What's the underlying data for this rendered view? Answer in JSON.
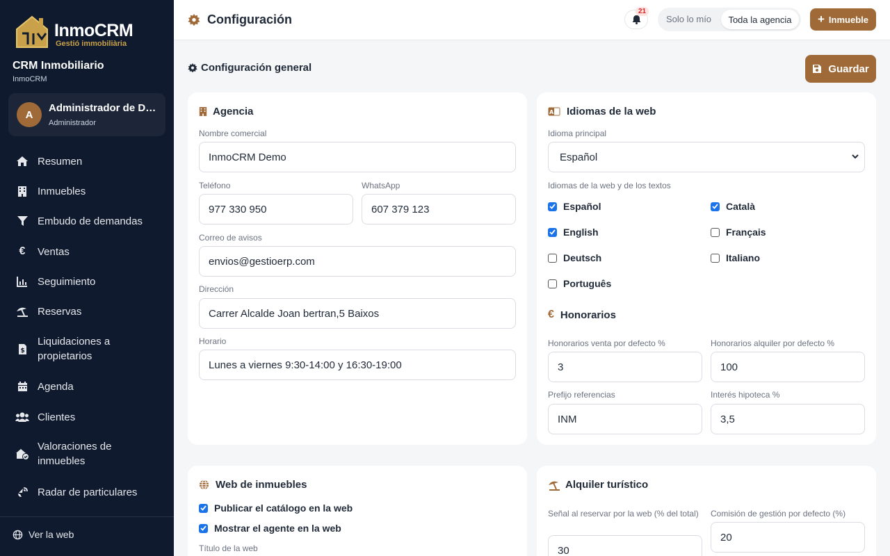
{
  "brand": {
    "name": "InmoCRM",
    "tagline": "Gestió immobiliària",
    "accent": "#a06a38"
  },
  "app": {
    "title": "CRM Inmobiliario",
    "subtitle": "InmoCRM"
  },
  "user": {
    "initial": "A",
    "name": "Administrador de Demo",
    "role": "Administrador"
  },
  "nav": [
    {
      "label": "Resumen",
      "icon": "home-icon"
    },
    {
      "label": "Inmuebles",
      "icon": "building-icon"
    },
    {
      "label": "Embudo de demandas",
      "icon": "funnel-icon"
    },
    {
      "label": "Ventas",
      "icon": "euro-icon"
    },
    {
      "label": "Seguimiento",
      "icon": "chart-icon"
    },
    {
      "label": "Reservas",
      "icon": "umbrella-beach-icon"
    },
    {
      "label": "Liquidaciones a propietarios",
      "icon": "receipt-icon"
    },
    {
      "label": "Agenda",
      "icon": "calendar-icon"
    },
    {
      "label": "Clientes",
      "icon": "users-icon"
    },
    {
      "label": "Valoraciones de inmuebles",
      "icon": "house-check-icon"
    },
    {
      "label": "Radar de particulares",
      "icon": "radar-icon"
    }
  ],
  "footer": {
    "ver_web": "Ver la web"
  },
  "topbar": {
    "title": "Configuración",
    "notifications": "21",
    "scope_options": [
      "Solo lo mío",
      "Toda la agencia"
    ],
    "scope_selected": "Toda la agencia",
    "add_button": "Inmueble"
  },
  "section": {
    "title": "Configuración general",
    "save": "Guardar"
  },
  "agencia": {
    "title": "Agencia",
    "nombre_label": "Nombre comercial",
    "nombre": "InmoCRM Demo",
    "telefono_label": "Teléfono",
    "telefono": "977 330 950",
    "whatsapp_label": "WhatsApp",
    "whatsapp": "607 379 123",
    "correo_label": "Correo de avisos",
    "correo": "envios@gestioerp.com",
    "direccion_label": "Dirección",
    "direccion": "Carrer Alcalde Joan bertran,5 Baixos",
    "horario_label": "Horario",
    "horario": "Lunes a viernes 9:30-14:00 y 16:30-19:00"
  },
  "idiomas": {
    "title": "Idiomas de la web",
    "principal_label": "Idioma principal",
    "principal": "Español",
    "textos_label": "Idiomas de la web y de los textos",
    "langs": [
      {
        "label": "Español",
        "checked": true
      },
      {
        "label": "Català",
        "checked": true
      },
      {
        "label": "English",
        "checked": true
      },
      {
        "label": "Français",
        "checked": false
      },
      {
        "label": "Deutsch",
        "checked": false
      },
      {
        "label": "Italiano",
        "checked": false
      },
      {
        "label": "Português",
        "checked": false
      }
    ]
  },
  "honorarios": {
    "title": "Honorarios",
    "venta_label": "Honorarios venta por defecto %",
    "venta": "3",
    "alquiler_label": "Honorarios alquiler por defecto %",
    "alquiler": "100",
    "prefijo_label": "Prefijo referencias",
    "prefijo": "INM",
    "interes_label": "Interés hipoteca %",
    "interes": "3,5"
  },
  "web": {
    "title": "Web de inmuebles",
    "publicar": "Publicar el catálogo en la web",
    "publicar_checked": true,
    "mostrar": "Mostrar el agente en la web",
    "mostrar_checked": true,
    "titulo_label": "Título de la web"
  },
  "turistico": {
    "title": "Alquiler turístico",
    "senal_label": "Señal al reservar por la web (% del total)",
    "senal": "30",
    "comision_label": "Comisión de gestión por defecto (%)",
    "comision": "20"
  }
}
